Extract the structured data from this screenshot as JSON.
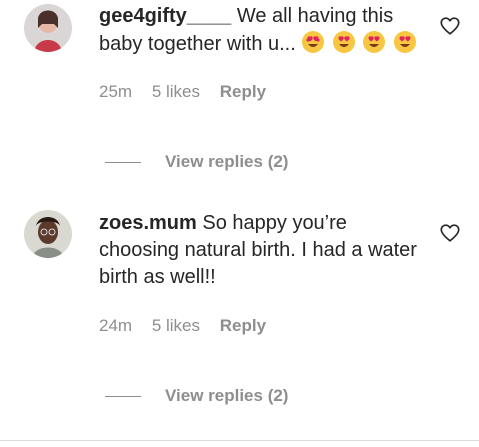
{
  "comments": [
    {
      "username": "gee4gifty____",
      "text": " We all having this baby together with u... ",
      "emoji_count": 4,
      "time": "25m",
      "likes": "5 likes",
      "reply_label": "Reply",
      "view_replies": "View replies (2)",
      "avatar_colors": [
        "#c93a48",
        "#e7b7a7"
      ]
    },
    {
      "username": "zoes.mum",
      "text": " So happy you’re choosing natural birth. I had a water birth as well!!",
      "time": "24m",
      "likes": "5 likes",
      "reply_label": "Reply",
      "view_replies": "View replies (2)",
      "avatar_colors": [
        "#5b3a2b",
        "#d9d9d2"
      ]
    }
  ],
  "icons": {
    "like": "heart-outline-icon",
    "emoji": "heart-eyes-emoji-icon"
  }
}
